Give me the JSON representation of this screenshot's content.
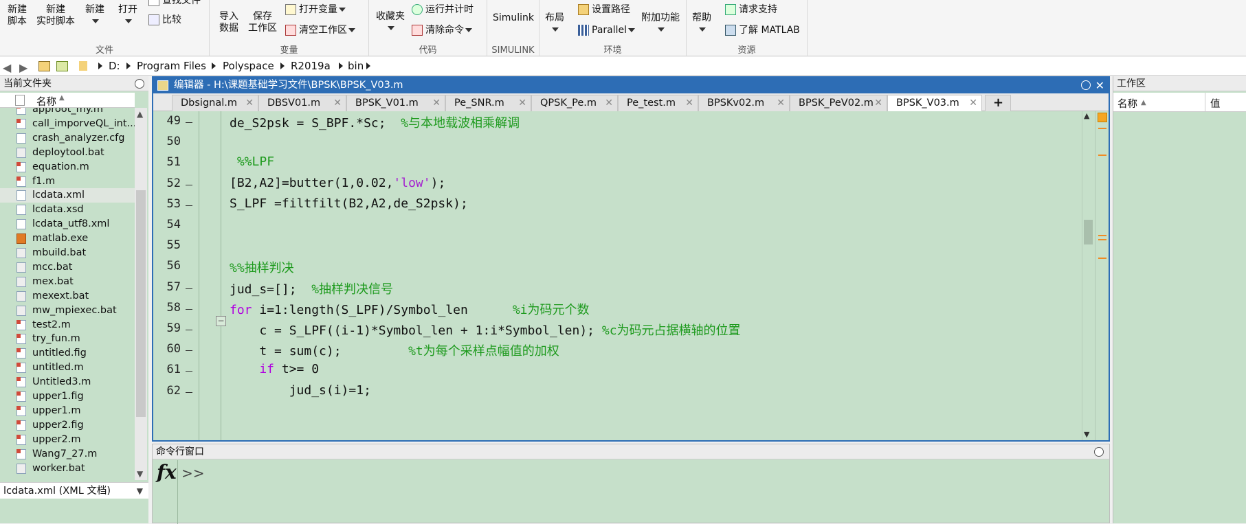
{
  "ribbon": {
    "file": {
      "label": "文件",
      "new_script": "新建\n脚本",
      "new_live_script": "新建\n实时脚本",
      "new": "新建",
      "open": "打开",
      "find_files": "查找文件",
      "compare": "比较"
    },
    "variable": {
      "label": "变量",
      "import": "导入\n数据",
      "save_workspace": "保存\n工作区",
      "open_variable": "打开变量",
      "clear_workspace": "清空工作区"
    },
    "code": {
      "label": "代码",
      "favorites": "收藏夹",
      "run_timing": "运行并计时",
      "clear_commands": "清除命令"
    },
    "simulink": {
      "label": "SIMULINK",
      "simulink": "Simulink"
    },
    "environment": {
      "label": "环境",
      "layout": "布局",
      "set_path": "设置路径",
      "parallel": "Parallel",
      "addons": "附加功能"
    },
    "resources": {
      "label": "资源",
      "help": "帮助",
      "request_support": "请求支持",
      "learn_matlab": "了解 MATLAB"
    }
  },
  "address": {
    "crumbs": [
      "D:",
      "Program Files",
      "Polyspace",
      "R2019a",
      "bin"
    ]
  },
  "filepanel": {
    "title": "当前文件夹",
    "column": "名称",
    "files": [
      {
        "name": "approot_my.m",
        "type": "m"
      },
      {
        "name": "call_imporveQL_int...",
        "type": "m"
      },
      {
        "name": "crash_analyzer.cfg",
        "type": "doc"
      },
      {
        "name": "deploytool.bat",
        "type": "bat"
      },
      {
        "name": "equation.m",
        "type": "m"
      },
      {
        "name": "f1.m",
        "type": "m"
      },
      {
        "name": "lcdata.xml",
        "type": "doc",
        "selected": true
      },
      {
        "name": "lcdata.xsd",
        "type": "doc"
      },
      {
        "name": "lcdata_utf8.xml",
        "type": "doc"
      },
      {
        "name": "matlab.exe",
        "type": "exe"
      },
      {
        "name": "mbuild.bat",
        "type": "bat"
      },
      {
        "name": "mcc.bat",
        "type": "bat"
      },
      {
        "name": "mex.bat",
        "type": "bat"
      },
      {
        "name": "mexext.bat",
        "type": "bat"
      },
      {
        "name": "mw_mpiexec.bat",
        "type": "bat"
      },
      {
        "name": "test2.m",
        "type": "m"
      },
      {
        "name": "try_fun.m",
        "type": "m"
      },
      {
        "name": "untitled.fig",
        "type": "fig"
      },
      {
        "name": "untitled.m",
        "type": "m"
      },
      {
        "name": "Untitled3.m",
        "type": "m"
      },
      {
        "name": "upper1.fig",
        "type": "fig"
      },
      {
        "name": "upper1.m",
        "type": "m"
      },
      {
        "name": "upper2.fig",
        "type": "fig"
      },
      {
        "name": "upper2.m",
        "type": "m"
      },
      {
        "name": "Wang7_27.m",
        "type": "m"
      },
      {
        "name": "worker.bat",
        "type": "bat"
      }
    ],
    "details": "lcdata.xml  (XML 文档)"
  },
  "editor": {
    "title": "编辑器 - H:\\课题基础学习文件\\BPSK\\BPSK_V03.m",
    "tabs": [
      "Dbsignal.m",
      "DBSV01.m",
      "BPSK_V01.m",
      "Pe_SNR.m",
      "QPSK_Pe.m",
      "Pe_test.m",
      "BPSKv02.m",
      "BPSK_PeV02.m",
      "BPSK_V03.m"
    ],
    "active_tab": "BPSK_V03.m",
    "lines": [
      {
        "n": "49",
        "dash": true,
        "code": "de_S2psk = S_BPF.*Sc;  ",
        "comment": "%与本地载波相乘解调"
      },
      {
        "n": "50",
        "dash": false,
        "code": "",
        "comment": ""
      },
      {
        "n": "51",
        "dash": false,
        "code": " ",
        "comment": "%%LPF"
      },
      {
        "n": "52",
        "dash": true,
        "code": "[B2,A2]=butter(1,0.02,",
        "string": "'low'",
        "after": ");",
        "comment": ""
      },
      {
        "n": "53",
        "dash": true,
        "code": "S_LPF =filtfilt(B2,A2,de_S2psk);",
        "comment": ""
      },
      {
        "n": "54",
        "dash": false,
        "code": "",
        "comment": ""
      },
      {
        "n": "55",
        "dash": false,
        "code": "",
        "comment": ""
      },
      {
        "n": "56",
        "dash": false,
        "code": "",
        "comment": "%%抽样判决"
      },
      {
        "n": "57",
        "dash": true,
        "code": "jud_s=[];  ",
        "comment": "%抽样判决信号"
      },
      {
        "n": "58",
        "dash": true,
        "kw": "for",
        "code": " i=1:length(S_LPF)/Symbol_len      ",
        "comment": "%i为码元个数"
      },
      {
        "n": "59",
        "dash": true,
        "code": "    c = S_LPF((i-1)*Symbol_len + 1:i*Symbol_len); ",
        "comment": "%c为码元占据横轴的位置"
      },
      {
        "n": "60",
        "dash": true,
        "code": "    t = sum(c);         ",
        "comment": "%t为每个采样点幅值的加权"
      },
      {
        "n": "61",
        "dash": true,
        "kw": "    if",
        "code": " t>= 0",
        "comment": ""
      },
      {
        "n": "62",
        "dash": true,
        "code": "        jud_s(i)=1;",
        "comment": ""
      }
    ]
  },
  "command_window": {
    "title": "命令行窗口",
    "prompt": "fx",
    "chevrons": ">>"
  },
  "workspace": {
    "title": "工作区",
    "col_name": "名称",
    "col_value": "值"
  },
  "colors": {
    "accent": "#2d6db5",
    "background_green": "#c6e0ca",
    "comment": "#1d9a1d",
    "keyword": "#b000e0"
  }
}
